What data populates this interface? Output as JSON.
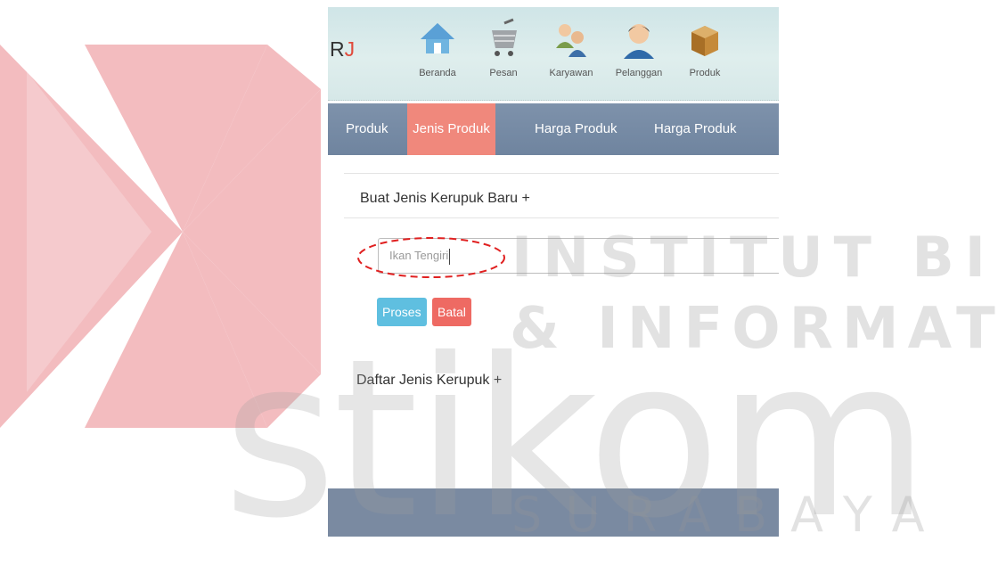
{
  "header": {
    "brand": "RJ",
    "nav": [
      {
        "label": "Beranda",
        "icon": "home-icon"
      },
      {
        "label": "Pesan",
        "icon": "cart-icon"
      },
      {
        "label": "Karyawan",
        "icon": "employees-icon"
      },
      {
        "label": "Pelanggan",
        "icon": "customer-icon"
      },
      {
        "label": "Produk",
        "icon": "box-icon"
      }
    ]
  },
  "tabs": [
    {
      "label": "Produk",
      "active": false
    },
    {
      "label": "Jenis Produk",
      "active": true
    },
    {
      "label": "Harga Produk",
      "active": false
    },
    {
      "label": "Harga Produk",
      "active": false
    }
  ],
  "form": {
    "title": "Buat Jenis Kerupuk Baru +",
    "input_value": "Ikan Tengiri",
    "proses_label": "Proses",
    "batal_label": "Batal"
  },
  "list": {
    "title": "Daftar Jenis Kerupuk +"
  },
  "watermark": {
    "line1": "INSTITUT BISNIS",
    "line2": "& INFORMATIKA",
    "brand": "stikom",
    "city": "SURABAYA"
  },
  "colors": {
    "active_tab": "#f0887c",
    "tabbar": "#7b8fa8",
    "proses": "#5fbfe0",
    "batal": "#ee6a63",
    "footer": "#7a8aa1",
    "highlight": "#e02020"
  }
}
